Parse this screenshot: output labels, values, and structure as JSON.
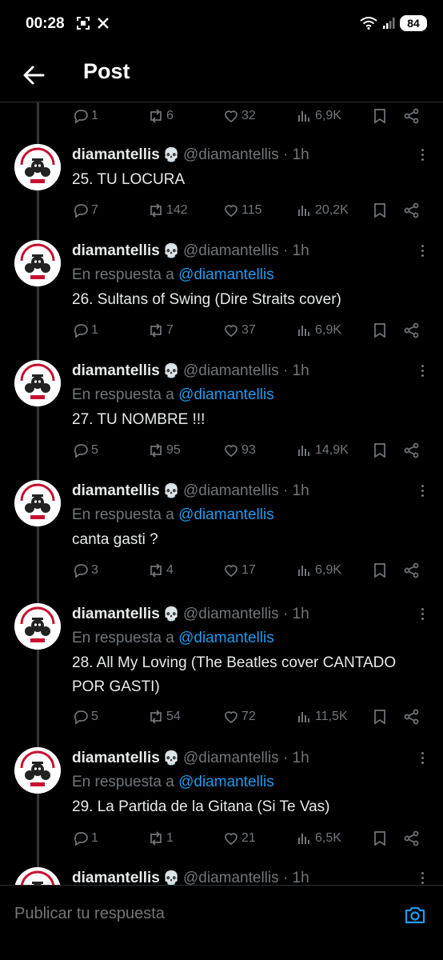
{
  "status_bar": {
    "time": "00:28",
    "icons": [
      "screenshot-icon",
      "x-logo-icon"
    ],
    "battery": "84"
  },
  "header": {
    "title": "Post"
  },
  "top_actions": {
    "replies": "1",
    "retweets": "6",
    "likes": "32",
    "views": "6,9K"
  },
  "tweets": [
    {
      "name": "diamantellis",
      "handle": "@diamantellis · 1h",
      "reply_prefix": "",
      "reply_to": "",
      "text": "25. TU LOCURA",
      "replies": "7",
      "retweets": "142",
      "likes": "115",
      "views": "20,2K"
    },
    {
      "name": "diamantellis",
      "handle": "@diamantellis · 1h",
      "reply_prefix": "En respuesta a",
      "reply_to": "@diamantellis",
      "text": "26. Sultans of Swing (Dire Straits cover)",
      "replies": "1",
      "retweets": "7",
      "likes": "37",
      "views": "6,9K"
    },
    {
      "name": "diamantellis",
      "handle": "@diamantellis · 1h",
      "reply_prefix": "En respuesta a",
      "reply_to": "@diamantellis",
      "text": "27. TU NOMBRE !!!",
      "replies": "5",
      "retweets": "95",
      "likes": "93",
      "views": "14,9K"
    },
    {
      "name": "diamantellis",
      "handle": "@diamantellis · 1h",
      "reply_prefix": "En respuesta a",
      "reply_to": "@diamantellis",
      "text": "canta gasti ?",
      "replies": "3",
      "retweets": "4",
      "likes": "17",
      "views": "6,9K"
    },
    {
      "name": "diamantellis",
      "handle": "@diamantellis · 1h",
      "reply_prefix": "En respuesta a",
      "reply_to": "@diamantellis",
      "text": "28. All My Loving (The Beatles cover CANTADO POR GASTI)",
      "replies": "5",
      "retweets": "54",
      "likes": "72",
      "views": "11,5K"
    },
    {
      "name": "diamantellis",
      "handle": "@diamantellis · 1h",
      "reply_prefix": "En respuesta a",
      "reply_to": "@diamantellis",
      "text": "29. La Partida de la Gitana (Si Te Vas)",
      "replies": "1",
      "retweets": "1",
      "likes": "21",
      "views": "6,5K"
    },
    {
      "name": "diamantellis",
      "handle": "@diamantellis · 1h",
      "reply_prefix": "",
      "reply_to": "",
      "text": "",
      "replies": "",
      "retweets": "",
      "likes": "",
      "views": ""
    }
  ],
  "skull": "💀",
  "avatar_text": {
    "top": "DIAMANTELLIS",
    "bottom": "AIRBAG"
  },
  "reply_bar": {
    "placeholder": "Publicar tu respuesta"
  },
  "colors": {
    "background": "#000000",
    "text": "#e7e9ea",
    "muted": "#71767b",
    "accent": "#1d9bf0",
    "divider": "#2f3336",
    "avatar_red": "#c8102e"
  }
}
